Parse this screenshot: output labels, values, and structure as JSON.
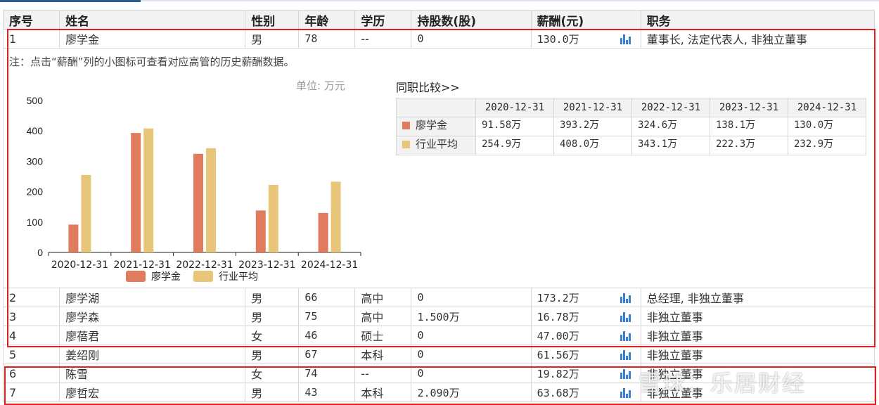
{
  "table": {
    "headers": [
      "序号",
      "姓名",
      "性别",
      "年龄",
      "学历",
      "持股数(股)",
      "薪酬(元)",
      "职务"
    ],
    "first_row": {
      "no": "1",
      "name": "廖学金",
      "gender": "男",
      "age": "78",
      "edu": "--",
      "shares": "0",
      "salary": "130.0万",
      "title": "董事长, 法定代表人, 非独立董事"
    },
    "rows": [
      {
        "no": "2",
        "name": "廖学湖",
        "gender": "男",
        "age": "66",
        "edu": "高中",
        "shares": "0",
        "salary": "173.2万",
        "title": "总经理, 非独立董事"
      },
      {
        "no": "3",
        "name": "廖学森",
        "gender": "男",
        "age": "75",
        "edu": "高中",
        "shares": "1.500万",
        "salary": "16.78万",
        "title": "非独立董事"
      },
      {
        "no": "4",
        "name": "廖蓓君",
        "gender": "女",
        "age": "46",
        "edu": "硕士",
        "shares": "0",
        "salary": "47.00万",
        "title": "非独立董事"
      },
      {
        "no": "5",
        "name": "姜绍刚",
        "gender": "男",
        "age": "67",
        "edu": "本科",
        "shares": "0",
        "salary": "61.56万",
        "title": "非独立董事"
      },
      {
        "no": "6",
        "name": "陈雪",
        "gender": "女",
        "age": "74",
        "edu": "--",
        "shares": "0",
        "salary": "19.82万",
        "title": "非独立董事"
      },
      {
        "no": "7",
        "name": "廖哲宏",
        "gender": "男",
        "age": "43",
        "edu": "本科",
        "shares": "2.090万",
        "salary": "63.68万",
        "title": "非独立董事"
      }
    ]
  },
  "detail": {
    "note": "注：点击“薪酬”列的小图标可查看对应高管的历史薪酬数据。",
    "unit": "单位: 万元",
    "compare_link": "同职比较>>",
    "compare_table": {
      "dates": [
        "2020-12-31",
        "2021-12-31",
        "2022-12-31",
        "2023-12-31",
        "2024-12-31"
      ],
      "rows": [
        {
          "label": "廖学金",
          "color": "#e07b5e",
          "values": [
            "91.58万",
            "393.2万",
            "324.6万",
            "138.1万",
            "130.0万"
          ]
        },
        {
          "label": "行业平均",
          "color": "#e8c679",
          "values": [
            "254.9万",
            "408.0万",
            "343.1万",
            "222.3万",
            "232.9万"
          ]
        }
      ]
    }
  },
  "chart_data": {
    "type": "bar",
    "categories": [
      "2020-12-31",
      "2021-12-31",
      "2022-12-31",
      "2023-12-31",
      "2024-12-31"
    ],
    "series": [
      {
        "name": "廖学金",
        "color": "#e07b5e",
        "values": [
          91.58,
          393.2,
          324.6,
          138.1,
          130.0
        ]
      },
      {
        "name": "行业平均",
        "color": "#e8c679",
        "values": [
          254.9,
          408.0,
          343.1,
          222.3,
          232.9
        ]
      }
    ],
    "yticks": [
      0,
      100,
      200,
      300,
      400,
      500
    ],
    "ylim": [
      0,
      500
    ],
    "legend": "bottom"
  },
  "watermark": "雪球：乐居财经",
  "icons": {
    "salary_chart": "bar-chart-icon"
  },
  "colors": {
    "highlight_box": "#e0201c",
    "icon": "#3a7fd0"
  }
}
